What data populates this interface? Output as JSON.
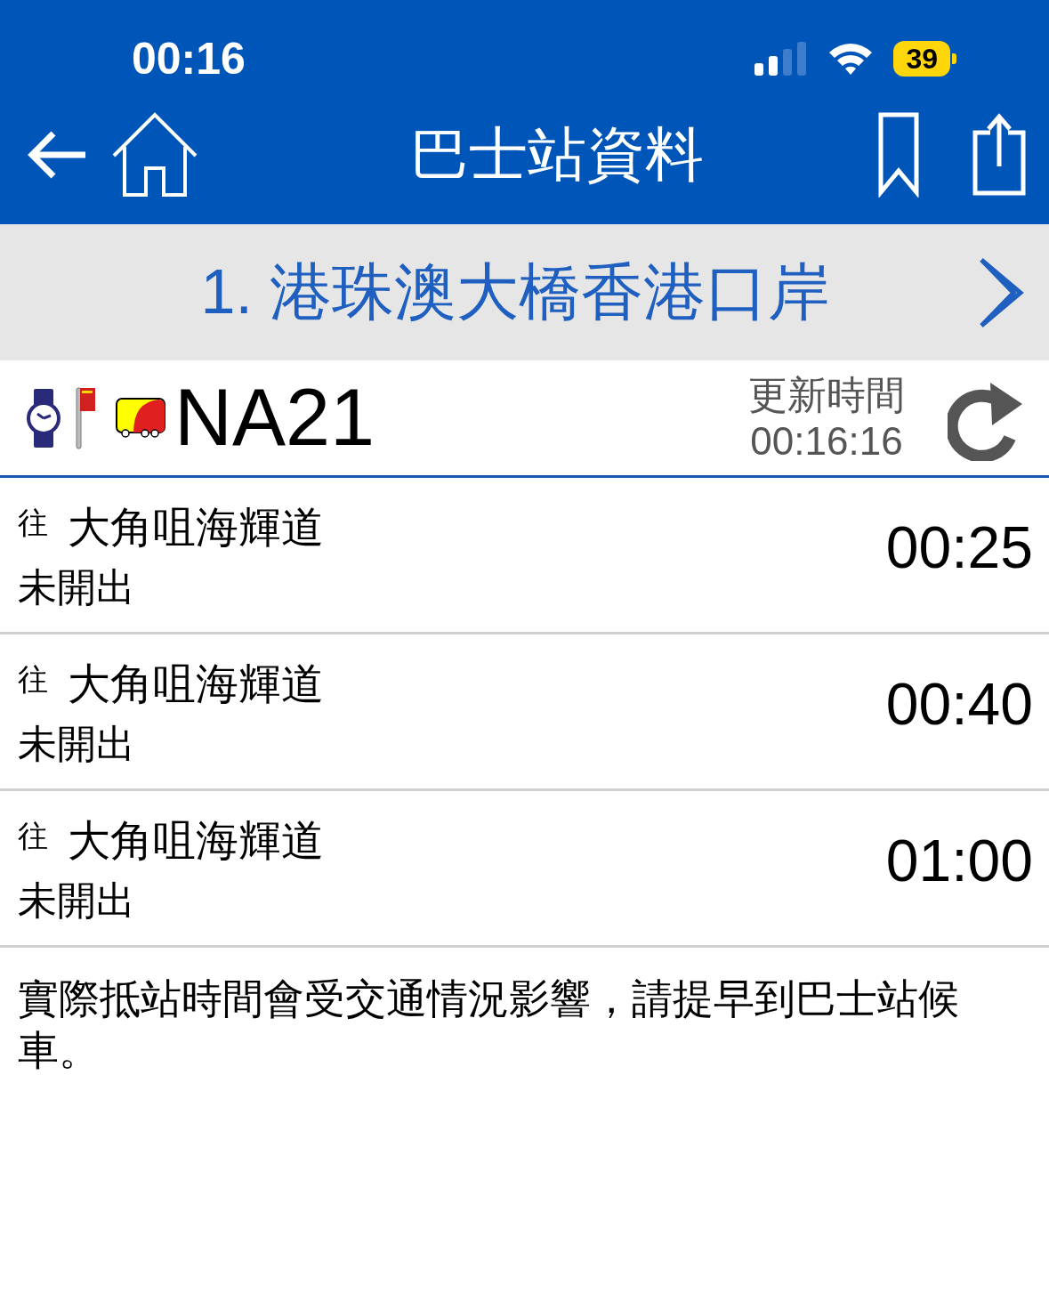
{
  "status_bar": {
    "time": "00:16",
    "battery": "39"
  },
  "header": {
    "title": "巴士站資料"
  },
  "stop": {
    "name": "1. 港珠澳大橋香港口岸"
  },
  "route": {
    "number": "NA21",
    "updated_label": "更新時間",
    "updated_time": "00:16:16"
  },
  "departures": [
    {
      "prefix": "往",
      "destination": "大角咀海輝道",
      "status": "未開出",
      "time": "00:25"
    },
    {
      "prefix": "往",
      "destination": "大角咀海輝道",
      "status": "未開出",
      "time": "00:40"
    },
    {
      "prefix": "往",
      "destination": "大角咀海輝道",
      "status": "未開出",
      "time": "01:00"
    }
  ],
  "note": "實際抵站時間會受交通情況影響，請提早到巴士站候車。"
}
